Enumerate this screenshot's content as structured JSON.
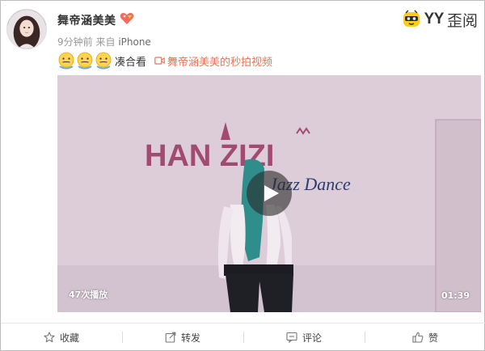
{
  "post": {
    "username": "舞帝涵美美",
    "time": "9分钟前",
    "source_prefix": "来自",
    "source": "iPhone",
    "emoji_count": 3,
    "text": "凑合看",
    "video_link_label": "舞帝涵美美的秒拍视频"
  },
  "brand": {
    "logo_text": "YY",
    "logo_cn": "歪阅",
    "icon": "yy-mascot-icon"
  },
  "video": {
    "wall_text_1": "HAN  ZIZI",
    "wall_text_2": "Jazz Dance",
    "view_count": "47次播放",
    "duration": "01:39",
    "play_icon": "play-icon"
  },
  "actions": [
    {
      "label": "收藏",
      "icon": "star-icon"
    },
    {
      "label": "转发",
      "icon": "share-icon"
    },
    {
      "label": "评论",
      "icon": "comment-icon"
    },
    {
      "label": "赞",
      "icon": "thumbs-up-icon"
    }
  ],
  "colors": {
    "accent": "#eb7350",
    "meta_gray": "#999999"
  }
}
